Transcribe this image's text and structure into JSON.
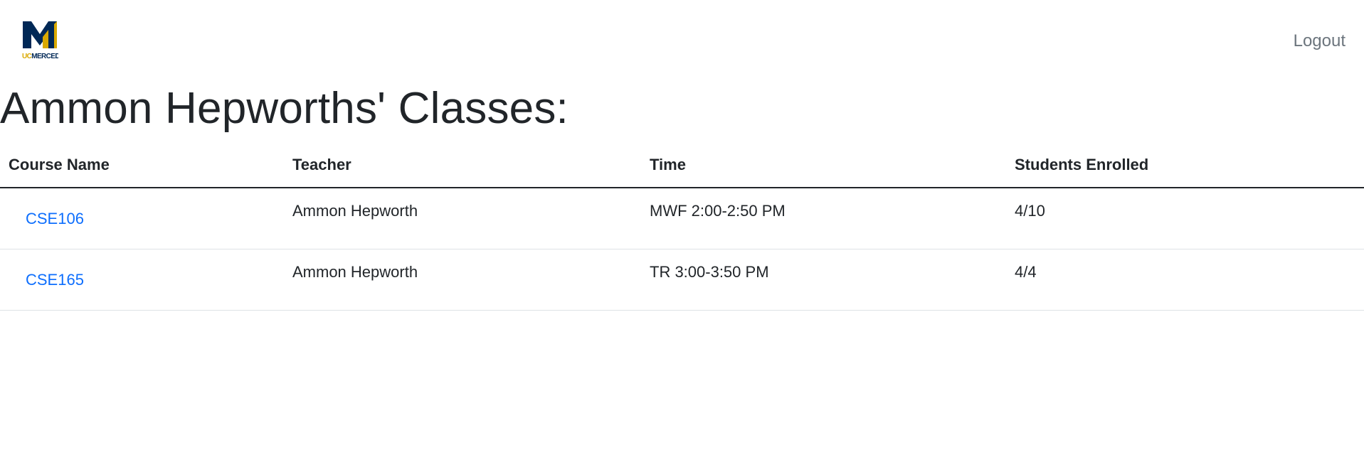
{
  "navbar": {
    "logo_text": "UCMERCED",
    "logout_label": "Logout"
  },
  "page": {
    "title": "Ammon Hepworths' Classes:"
  },
  "table": {
    "headers": [
      "Course Name",
      "Teacher",
      "Time",
      "Students Enrolled"
    ],
    "rows": [
      {
        "course": "CSE106",
        "teacher": "Ammon Hepworth",
        "time": "MWF 2:00-2:50 PM",
        "enrolled": "4/10"
      },
      {
        "course": "CSE165",
        "teacher": "Ammon Hepworth",
        "time": "TR 3:00-3:50 PM",
        "enrolled": "4/4"
      }
    ]
  },
  "colors": {
    "brand_blue": "#002856",
    "brand_gold": "#DAA900",
    "link": "#0d6efd"
  }
}
